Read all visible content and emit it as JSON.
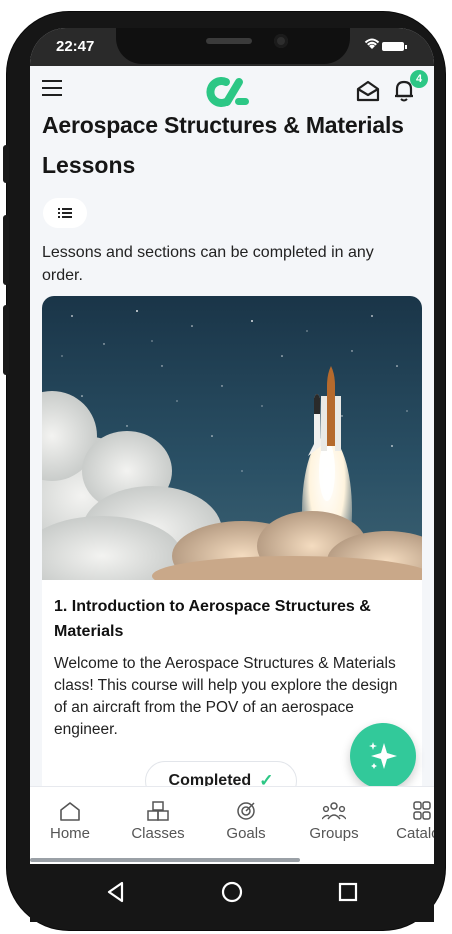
{
  "status_bar": {
    "time": "22:47"
  },
  "app_bar": {
    "notification_count": "4"
  },
  "course": {
    "title": "Aerospace Structures & Materials",
    "section_heading": "Lessons",
    "intro": "Lessons and sections can be completed in any order."
  },
  "lesson": {
    "title": "1. Introduction to Aerospace Structures & Materials",
    "description": "Welcome to the Aerospace Structures & Materials class! This course will help you explore the design of an aircraft from the POV of an aerospace engineer.",
    "status_label": "Completed",
    "image_icon": "rocket-launch-image"
  },
  "bottom_nav": {
    "items": [
      {
        "label": "Home",
        "icon": "home-icon"
      },
      {
        "label": "Classes",
        "icon": "cubes-icon"
      },
      {
        "label": "Goals",
        "icon": "target-icon"
      },
      {
        "label": "Groups",
        "icon": "people-icon"
      },
      {
        "label": "Catalog",
        "icon": "grid-icon"
      }
    ]
  },
  "colors": {
    "accent": "#2cc785",
    "fab": "#32c99a",
    "background": "#f4f6f9",
    "text": "#161616"
  }
}
